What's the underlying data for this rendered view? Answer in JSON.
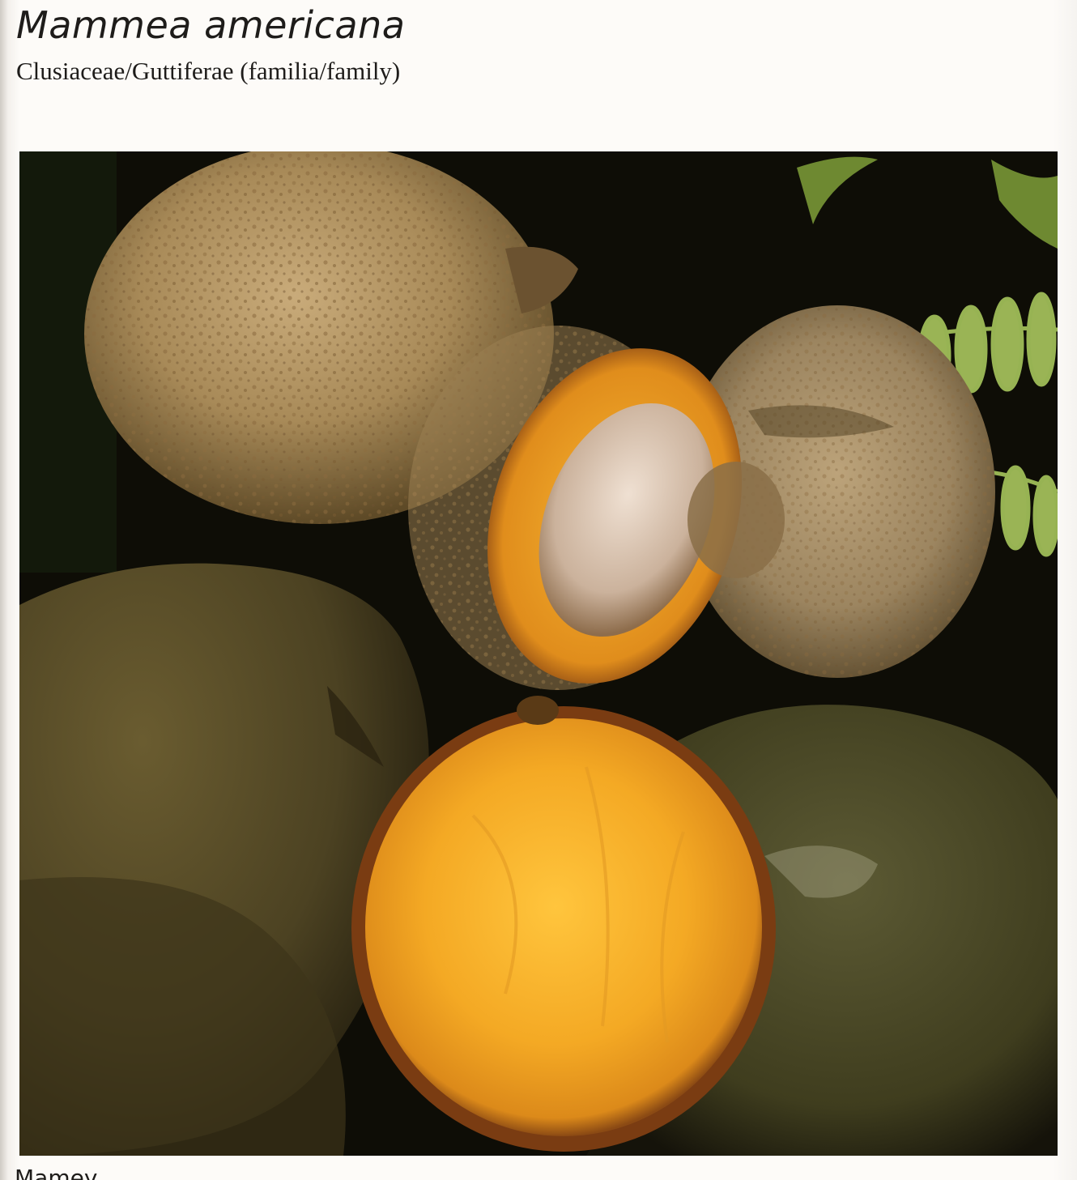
{
  "header": {
    "title": "Mammea americana",
    "subtitle": "Clusiaceae/Guttiferae (familia/family)"
  },
  "photo": {
    "subject": "mamey-fruits-photo",
    "colors": {
      "background": "#0d0c06",
      "rind": "#a88c5e",
      "flesh": "#f2a626",
      "rock": "#4e4524",
      "fern": "#9fbf52"
    }
  },
  "caption": {
    "text": "Mamey"
  }
}
